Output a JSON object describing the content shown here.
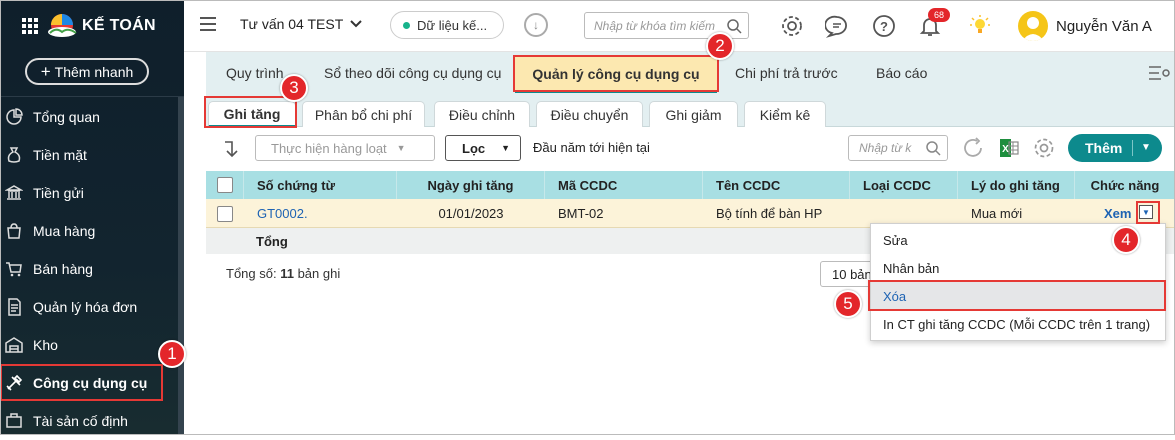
{
  "app": {
    "logo_text": "KẾ TOÁN",
    "quick_add_label": "Thêm nhanh"
  },
  "sidebar": {
    "items": [
      {
        "label": "Tổng quan",
        "icon": "chart-pie-icon"
      },
      {
        "label": "Tiền mặt",
        "icon": "money-bag-icon"
      },
      {
        "label": "Tiền gửi",
        "icon": "bank-icon"
      },
      {
        "label": "Mua hàng",
        "icon": "shopping-bag-icon"
      },
      {
        "label": "Bán hàng",
        "icon": "cart-icon"
      },
      {
        "label": "Quản lý hóa đơn",
        "icon": "invoice-icon"
      },
      {
        "label": "Kho",
        "icon": "warehouse-icon"
      },
      {
        "label": "Công cụ dụng cụ",
        "icon": "tools-icon"
      },
      {
        "label": "Tài sản cố định",
        "icon": "asset-icon"
      }
    ]
  },
  "topbar": {
    "company": "Tư vấn 04 TEST",
    "data_label": "Dữ liệu kế...",
    "search_placeholder": "Nhập từ khóa tìm kiếm",
    "notification_count": "68",
    "user_name": "Nguyễn Văn A"
  },
  "module_tabs": [
    "Quy trình",
    "Sổ theo dõi công cụ dụng cụ",
    "Quản lý công cụ dụng cụ",
    "Chi phí trả trước",
    "Báo cáo"
  ],
  "sub_tabs": [
    "Ghi tăng",
    "Phân bổ chi phí",
    "Điều chỉnh",
    "Điều chuyển",
    "Ghi giảm",
    "Kiểm kê"
  ],
  "toolbar": {
    "bulk_action": "Thực hiện hàng loạt",
    "filter_label": "Lọc",
    "period": "Đầu năm tới hiện tại",
    "grid_search_placeholder": "Nhập từ k",
    "add_label": "Thêm"
  },
  "table": {
    "columns": [
      "Số chứng từ",
      "Ngày ghi tăng",
      "Mã CCDC",
      "Tên CCDC",
      "Loại CCDC",
      "Lý do ghi tăng",
      "Chức năng"
    ],
    "rows": [
      {
        "doc_no": "GT0002.",
        "date": "01/01/2023",
        "code": "BMT-02",
        "name": "Bộ tính để bàn HP",
        "type": "",
        "reason": "Mua mới",
        "action": "Xem"
      }
    ],
    "summary_label": "Tổng",
    "total_prefix": "Tổng số: ",
    "total_count": "11",
    "total_suffix": " bản ghi",
    "page_size": "10 bản"
  },
  "context_menu": [
    "Sửa",
    "Nhân bản",
    "Xóa",
    "In CT ghi tăng CCDC (Mỗi CCDC trên 1 trang)"
  ],
  "callouts": [
    "1",
    "2",
    "3",
    "4",
    "5"
  ],
  "colors": {
    "accent": "#0d8a8d",
    "header_bg": "#a8dfe3",
    "callout": "#e3262a",
    "sidebar_bg": "#0f1f2b"
  }
}
